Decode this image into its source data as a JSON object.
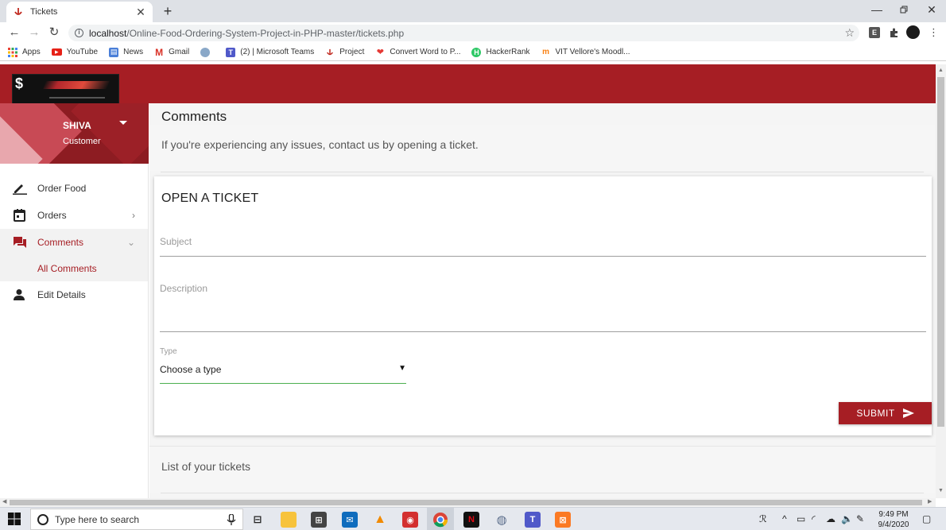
{
  "browser": {
    "tab_title": "Tickets",
    "url_host": "localhost",
    "url_path": "/Online-Food-Ordering-System-Project-in-PHP-master/tickets.php",
    "bookmarks": [
      {
        "label": "Apps",
        "icon": "apps-grid-icon"
      },
      {
        "label": "YouTube",
        "icon": "youtube-icon"
      },
      {
        "label": "News",
        "icon": "news-icon"
      },
      {
        "label": "Gmail",
        "icon": "gmail-icon"
      },
      {
        "label": "",
        "icon": "web-icon"
      },
      {
        "label": "(2) | Microsoft Teams",
        "icon": "teams-icon"
      },
      {
        "label": "Project",
        "icon": "project-icon"
      },
      {
        "label": "Convert Word to P...",
        "icon": "convert-icon"
      },
      {
        "label": "HackerRank",
        "icon": "hackerrank-icon"
      },
      {
        "label": "VIT Vellore's Moodl...",
        "icon": "moodle-icon"
      }
    ]
  },
  "user": {
    "name": "SHIVA",
    "role": "Customer"
  },
  "sidebar": {
    "items": [
      {
        "label": "Order Food",
        "icon": "pencil-icon"
      },
      {
        "label": "Orders",
        "icon": "calendar-icon"
      },
      {
        "label": "Comments",
        "icon": "comments-icon"
      },
      {
        "label": "All Comments"
      },
      {
        "label": "Edit Details",
        "icon": "person-icon"
      }
    ]
  },
  "page": {
    "title": "Comments",
    "subtitle": "If you're experiencing any issues, contact us by opening a ticket.",
    "form": {
      "title": "OPEN A TICKET",
      "subject_placeholder": "Subject",
      "description_placeholder": "Description",
      "type_label": "Type",
      "type_value": "Choose a type",
      "submit_label": "SUBMIT"
    },
    "list_title": "List of your tickets"
  },
  "taskbar": {
    "search_placeholder": "Type here to search",
    "time": "9:49 PM",
    "date": "9/4/2020"
  },
  "colors": {
    "brand": "#a61e24",
    "focus_underline": "#4caf50"
  }
}
